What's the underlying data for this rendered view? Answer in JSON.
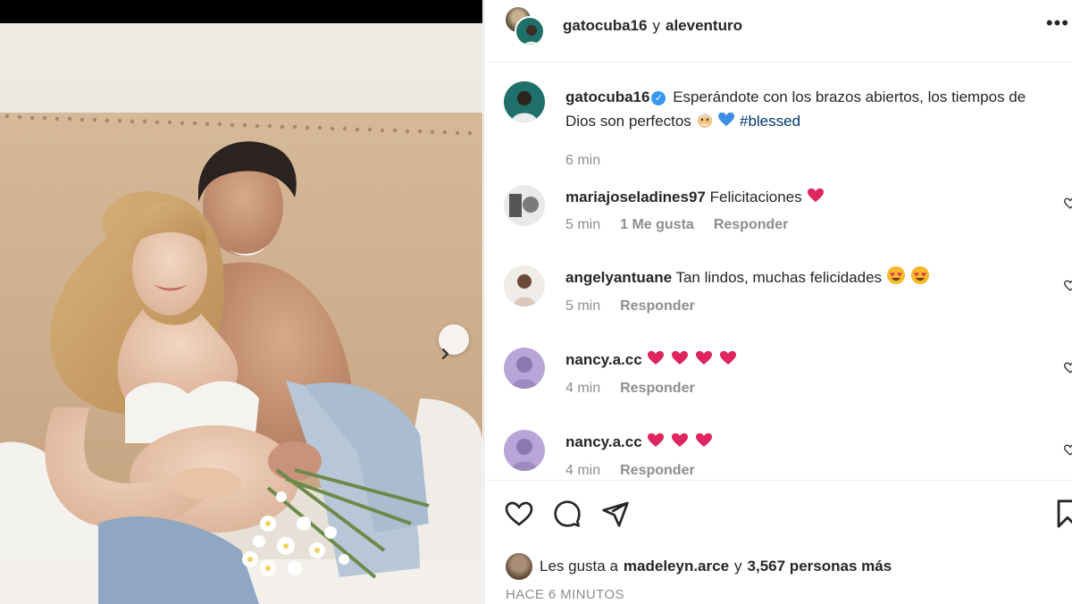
{
  "header": {
    "user1": "gatocuba16",
    "conj": "y",
    "user2": "aleventuro",
    "more": "•••"
  },
  "caption": {
    "user": "gatocuba16",
    "text": "Esperándote con los brazos abiertos, los tiempos de Dios son perfectos",
    "hashtag": "#blessed",
    "time": "6 min"
  },
  "comments": [
    {
      "user": "mariajoseladines97",
      "text": "Felicitaciones",
      "emoji_count": 1,
      "time": "5 min",
      "likes": "1 Me gusta",
      "reply": "Responder"
    },
    {
      "user": "angelyantuane",
      "text": "Tan lindos, muchas felicidades",
      "emoji_count": 2,
      "time": "5 min",
      "reply": "Responder"
    },
    {
      "user": "nancy.a.cc",
      "text": "",
      "emoji_count": 4,
      "time": "4 min",
      "reply": "Responder"
    },
    {
      "user": "nancy.a.cc",
      "text": "",
      "emoji_count": 3,
      "time": "4 min",
      "reply": "Responder"
    }
  ],
  "likes": {
    "prefix": "Les gusta a",
    "user": "madeleyn.arce",
    "conj": "y",
    "others": "3,567 personas más"
  },
  "time_ago": "HACE 6 MINUTOS",
  "icons": [
    "heart-icon",
    "comment-icon",
    "share-icon",
    "bookmark-icon",
    "chevron-right-icon",
    "more-icon",
    "verified-icon"
  ],
  "colors": {
    "hashtag": "#00376b",
    "verified": "#3897f0",
    "heart_emoji": "#e0245e",
    "muted": "#8e8e8e"
  }
}
